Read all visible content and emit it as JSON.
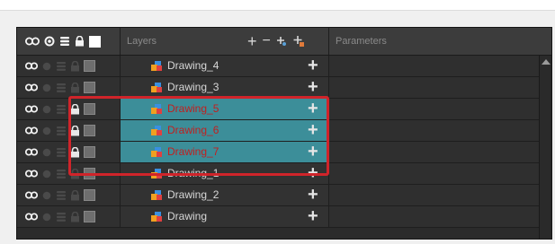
{
  "header": {
    "layers_label": "Layers",
    "parameters_label": "Parameters",
    "add_layer_glyph": "+",
    "remove_layer_glyph": "−",
    "add_drawing_glyph": "⁺",
    "add_peg_glyph": "⊕"
  },
  "rows": [
    {
      "name": "Drawing_4",
      "selected": false,
      "locked": false
    },
    {
      "name": "Drawing_3",
      "selected": false,
      "locked": false
    },
    {
      "name": "Drawing_5",
      "selected": true,
      "locked": true
    },
    {
      "name": "Drawing_6",
      "selected": true,
      "locked": true
    },
    {
      "name": "Drawing_7",
      "selected": true,
      "locked": true
    },
    {
      "name": "Drawing_1",
      "selected": false,
      "locked": false
    },
    {
      "name": "Drawing_2",
      "selected": false,
      "locked": false
    },
    {
      "name": "Drawing",
      "selected": false,
      "locked": false
    }
  ],
  "row_plus_glyph": "+",
  "colors": {
    "selection": "#3c8e99",
    "selected_text": "#c21f1f",
    "highlight_box": "#d0242a"
  }
}
